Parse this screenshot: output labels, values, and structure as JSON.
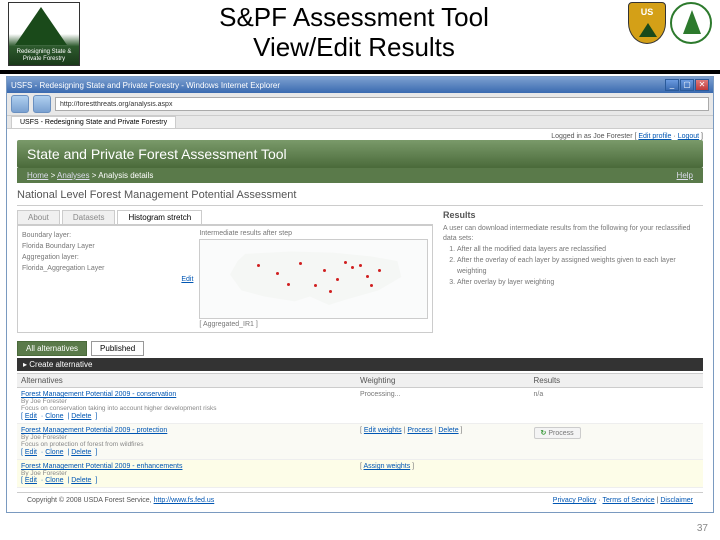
{
  "slide": {
    "title_line1": "S&PF Assessment Tool",
    "title_line2": "View/Edit Results",
    "left_logo_txt": "Redesigning\nState & Private Forestry",
    "page_number": "37"
  },
  "browser": {
    "window_title": "USFS - Redesigning State and Private Forestry - Windows Internet Explorer",
    "url": "http://forestthreats.org/analysis.aspx",
    "tab_label": "USFS - Redesigning State and Private Forestry"
  },
  "page": {
    "logged_in_label": "Logged in as",
    "logged_in_user": "Joe Forester",
    "edit_profile": "Edit profile",
    "logout": "Logout",
    "banner_title": "State and Private Forest Assessment Tool",
    "breadcrumbs": [
      "Home",
      "Analyses",
      "Analysis details"
    ],
    "help_label": "Help",
    "section_title": "National Level Forest Management Potential Assessment",
    "sub_tabs": {
      "about": "About",
      "datasets": "Datasets",
      "histogram": "Histogram stretch"
    },
    "layers": {
      "boundary": "Boundary layer:",
      "boundary_val": "Florida Boundary Layer",
      "agg": "Aggregation layer:",
      "agg_val": "Florida_Aggregation Layer",
      "edit": "Edit"
    },
    "map": {
      "title": "Intermediate results after step",
      "footer": "Aggregated_IR1"
    },
    "results": {
      "heading": "Results",
      "intro": "A user can download intermediate results from the following for your reclassified data sets:",
      "steps": [
        "After all the modified data layers are reclassified",
        "After the overlay of each layer by assigned weights given to each layer weighting",
        "After overlay by layer weighting"
      ]
    },
    "filters": {
      "all": "All alternatives",
      "published": "Published"
    },
    "create_label": "Create alternative",
    "alt_head": {
      "a": "Alternatives",
      "w": "Weighting",
      "r": "Results"
    },
    "alts": [
      {
        "name": "Forest Management Potential 2009 - conservation",
        "by": "By Joe Forester",
        "desc": "Focus on conservation taking into account higher development risks",
        "actions": [
          "Edit",
          "Clone",
          "Delete"
        ],
        "weighting": "Processing...",
        "results": "n/a"
      },
      {
        "name": "Forest Management Potential 2009 - protection",
        "by": "By Joe Forester",
        "desc": "Focus on protection of forest from wildfires",
        "actions": [
          "Edit",
          "Clone",
          "Delete"
        ],
        "weighting_links": [
          "Edit weights",
          "Process",
          "Delete"
        ],
        "result_btn": "Process"
      },
      {
        "name": "Forest Management Potential 2009 - enhancements",
        "by": "By Joe Forester",
        "actions": [
          "Edit",
          "Clone",
          "Delete"
        ],
        "weighting_links": [
          "Assign weights"
        ]
      }
    ],
    "footer": {
      "copyright": "Copyright © 2008 USDA Forest Service,",
      "site_url": "http://www.fs.fed.us",
      "links": [
        "Privacy Policy",
        "Terms of Service",
        "Disclaimer"
      ]
    }
  }
}
